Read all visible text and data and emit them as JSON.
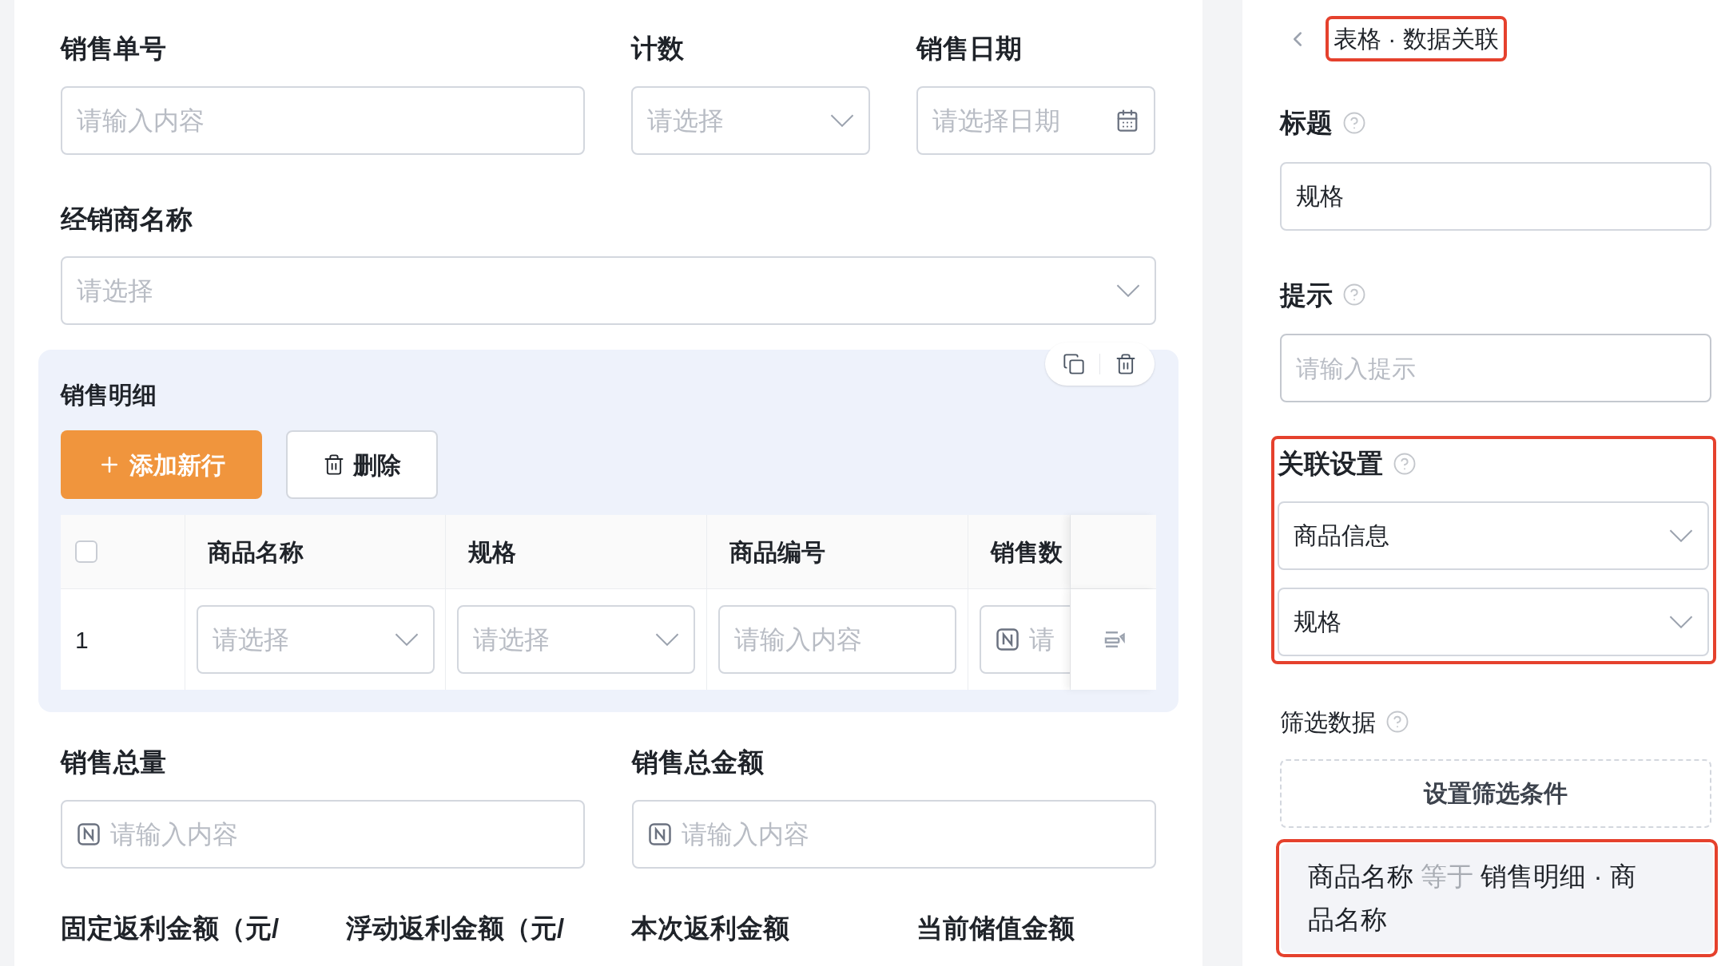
{
  "form_fields": [
    {
      "label": "销售单号",
      "kind": "text",
      "placeholder": "请输入内容"
    },
    {
      "label": "计数",
      "kind": "select",
      "placeholder": "请选择"
    },
    {
      "label": "销售日期",
      "kind": "date",
      "placeholder": "请选择日期"
    }
  ],
  "dealer_field": {
    "label": "经销商名称",
    "kind": "select",
    "placeholder": "请选择"
  },
  "subtable": {
    "title": "销售明细",
    "add_button": "添加新行",
    "delete_button": "删除",
    "select_all_checked": false,
    "columns": [
      "商品名称",
      "规格",
      "商品编号",
      "销售数"
    ],
    "rows": [
      {
        "index": "1",
        "cells": [
          {
            "kind": "select",
            "placeholder": "请选择"
          },
          {
            "kind": "select",
            "placeholder": "请选择"
          },
          {
            "kind": "text",
            "placeholder": "请输入内容"
          },
          {
            "kind": "number",
            "placeholder": "请"
          }
        ]
      }
    ]
  },
  "totals": [
    {
      "label": "销售总量",
      "kind": "number",
      "placeholder": "请输入内容"
    },
    {
      "label": "销售总金额",
      "kind": "number",
      "placeholder": "请输入内容"
    }
  ],
  "more_labels": [
    "固定返利金额（元/",
    "浮动返利金额（元/",
    "本次返利金额",
    "当前储值金额"
  ],
  "panel": {
    "title": "表格 · 数据关联",
    "title_highlighted": true,
    "title_field": {
      "label": "标题",
      "value": "规格"
    },
    "hint_field": {
      "label": "提示",
      "placeholder": "请输入提示"
    },
    "link": {
      "label": "关联设置",
      "highlighted": true,
      "selects": [
        "商品信息",
        "规格"
      ]
    },
    "filter": {
      "label": "筛选数据",
      "button": "设置筛选条件",
      "highlighted": true,
      "condition": {
        "field": "商品名称",
        "operator": "等于",
        "value": "销售明细 · 商品名称"
      }
    }
  }
}
